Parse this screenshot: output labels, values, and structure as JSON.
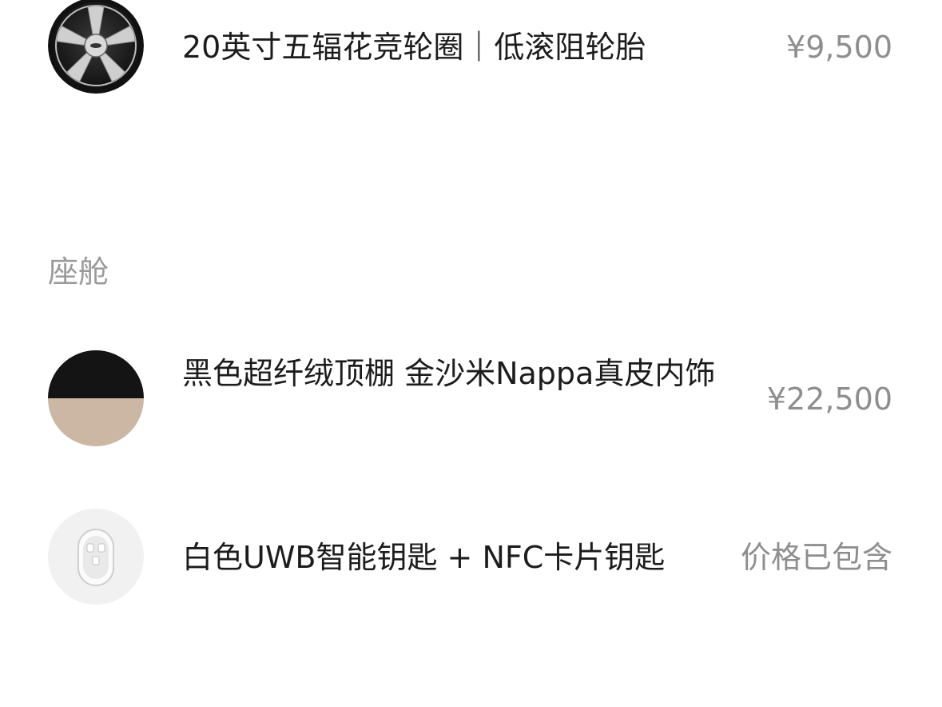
{
  "exterior": {
    "wheel_item": {
      "name": "20英寸五辐花竞轮圈｜低滚阻轮胎",
      "price": "¥9,500",
      "icon": "wheel-icon"
    }
  },
  "cabin": {
    "section_title": "座舱",
    "items": [
      {
        "name": "黑色超纤绒顶棚 金沙米Nappa真皮内饰",
        "price": "¥22,500",
        "icon": "interior-swatch-icon",
        "colors": [
          "#141414",
          "#ccb7a5"
        ]
      },
      {
        "name": "白色UWB智能钥匙 + NFC卡片钥匙",
        "price": "价格已包含",
        "icon": "key-fob-icon"
      }
    ]
  },
  "colors": {
    "text_primary": "#1c1c1c",
    "text_secondary": "#8e8e8e",
    "section_title": "#9a9a9a",
    "background": "#ffffff"
  }
}
